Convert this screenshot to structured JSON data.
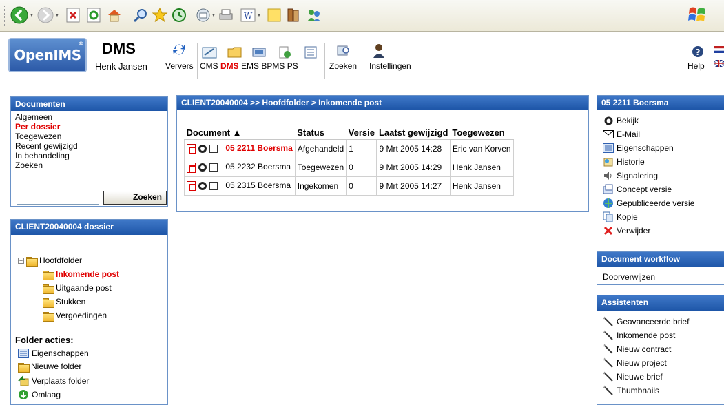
{
  "browser": {
    "toolbar_icons": [
      "back-icon",
      "forward-icon",
      "stop-icon",
      "refresh-icon",
      "home-icon",
      "search-icon",
      "favorites-icon",
      "history-icon",
      "mail-icon",
      "print-icon",
      "word-icon",
      "notes-icon",
      "research-icon",
      "messenger-icon"
    ]
  },
  "header": {
    "logo": "OpenIMS",
    "logo_mark": "®",
    "app_title": "DMS",
    "user": "Henk Jansen",
    "nav": {
      "ververs": "Ververs",
      "cms": "CMS",
      "dms": "DMS",
      "ems": "EMS",
      "bpms": "BPMS",
      "ps": "PS",
      "zoeken": "Zoeken",
      "instellingen": "Instellingen",
      "help": "Help"
    }
  },
  "documenten": {
    "title": "Documenten",
    "items": [
      "Algemeen",
      "Per dossier",
      "Toegewezen",
      "Recent gewijzigd",
      "In behandeling",
      "Zoeken"
    ],
    "active_index": 1,
    "search_value": "",
    "search_button": "Zoeken"
  },
  "dossier": {
    "title": "CLIENT20040004 dossier",
    "root": "Hoofdfolder",
    "folders": [
      "Inkomende post",
      "Uitgaande post",
      "Stukken",
      "Vergoedingen"
    ],
    "active_folder": "Inkomende post",
    "actions_title": "Folder acties:",
    "actions": [
      "Eigenschappen",
      "Nieuwe folder",
      "Verplaats folder",
      "Omlaag"
    ]
  },
  "documents_panel": {
    "breadcrumb": "CLIENT20040004 >> Hoofdfolder > Inkomende post",
    "columns": [
      "Document ▲",
      "Status",
      "Versie",
      "Laatst gewijzigd",
      "Toegewezen"
    ],
    "rows": [
      {
        "name": "05 2211 Boersma",
        "status": "Afgehandeld",
        "version": "1",
        "modified": "9 Mrt 2005 14:28",
        "assigned": "Eric van Korven",
        "active": true
      },
      {
        "name": "05 2232 Boersma",
        "status": "Toegewezen",
        "version": "0",
        "modified": "9 Mrt 2005 14:29",
        "assigned": "Henk Jansen",
        "active": false
      },
      {
        "name": "05 2315 Boersma",
        "status": "Ingekomen",
        "version": "0",
        "modified": "9 Mrt 2005 14:27",
        "assigned": "Henk Jansen",
        "active": false
      }
    ]
  },
  "document_actions": {
    "title": "05 2211 Boersma",
    "items": [
      "Bekijk",
      "E-Mail",
      "Eigenschappen",
      "Historie",
      "Signalering",
      "Concept versie",
      "Gepubliceerde versie",
      "Kopie",
      "Verwijder"
    ]
  },
  "workflow": {
    "title": "Document workflow",
    "items": [
      "Doorverwijzen"
    ]
  },
  "assistenten": {
    "title": "Assistenten",
    "items": [
      "Geavanceerde brief",
      "Inkomende post",
      "Nieuw contract",
      "Nieuw project",
      "Nieuwe brief",
      "Thumbnails"
    ]
  },
  "colors": {
    "panel_header": "#2a62b8",
    "active_red": "#e00000",
    "panel_border": "#6a92c8"
  }
}
